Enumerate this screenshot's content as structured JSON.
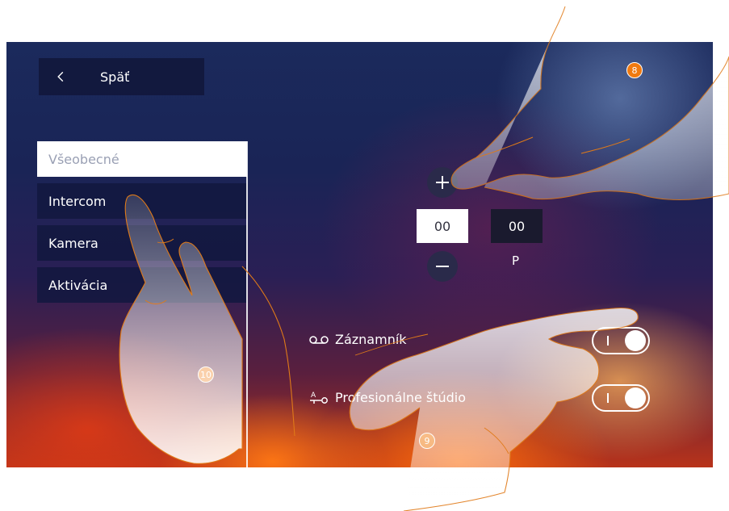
{
  "header": {
    "back_label": "Späť"
  },
  "menu": {
    "items": [
      {
        "label": "Všeobecné",
        "active": true
      },
      {
        "label": "Intercom",
        "active": false
      },
      {
        "label": "Kamera",
        "active": false
      },
      {
        "label": "Aktivácia",
        "active": false
      }
    ]
  },
  "stepper": {
    "value_1": "00",
    "value_2": "00",
    "unit_label": "P"
  },
  "settings": {
    "answering_machine_label": "Záznamník",
    "professional_studio_label": "Profesionálne štúdio"
  },
  "callouts": {
    "c8": "8",
    "c9": "9",
    "c10": "10"
  },
  "colors": {
    "callout": "#f07a10",
    "panel": "#12183e",
    "accent_white": "#ffffff"
  }
}
